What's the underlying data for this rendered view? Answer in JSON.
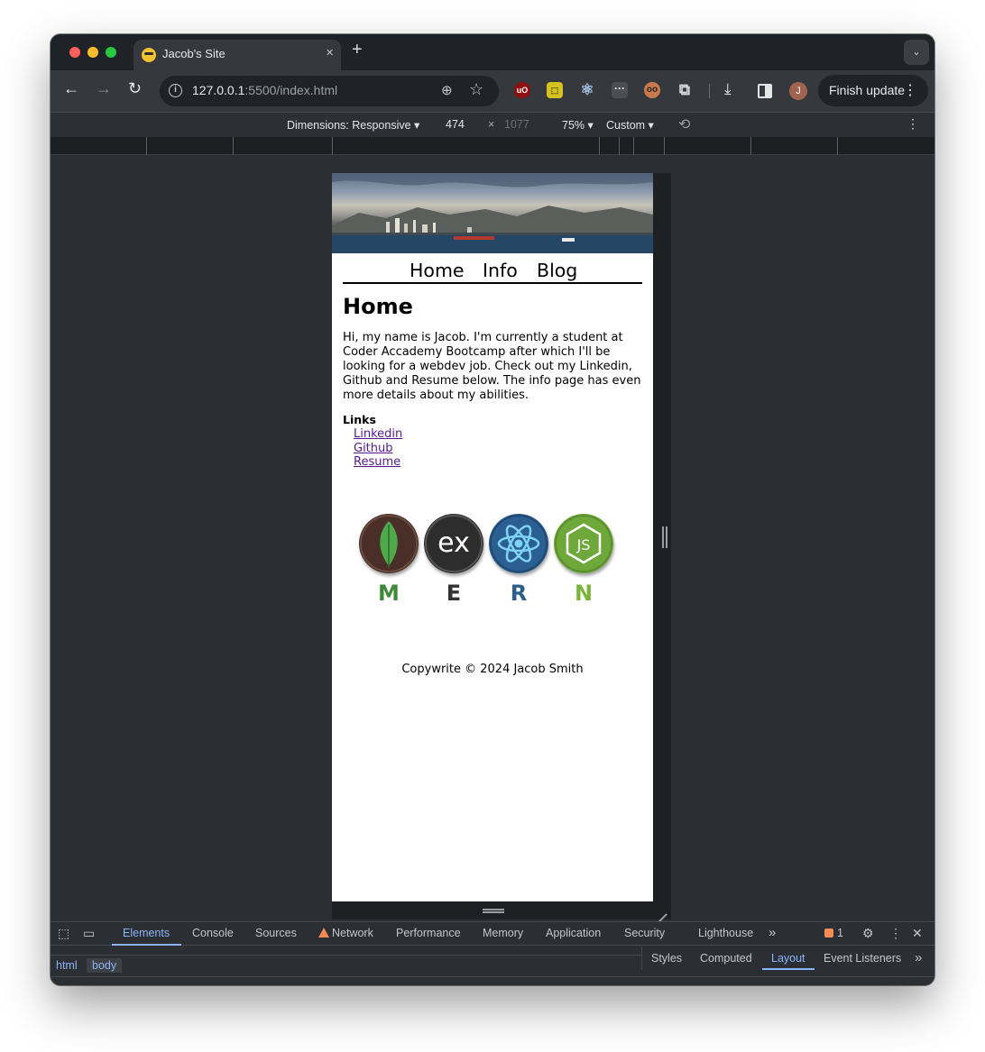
{
  "browser": {
    "tab": {
      "title": "Jacob's Site",
      "close_glyph": "×"
    },
    "new_tab_glyph": "+",
    "tab_search_glyph": "⌄",
    "url_host": "127.0.0.1",
    "url_path": ":5500/index.html",
    "info_glyph": "i",
    "profile_initial": "J",
    "finish_update_label": "Finish update",
    "colors": {
      "tab_bg": "#35393e",
      "window_bg": "#1f2327",
      "accent_blue": "#8ab4f8",
      "warning_orange": "#f28b54"
    }
  },
  "device_toolbar": {
    "dimensions_label": "Dimensions: Responsive ▾",
    "width": "474",
    "times_glyph": "×",
    "height": "1077",
    "zoom": "75% ▾",
    "throttle": "Custom ▾"
  },
  "site": {
    "nav": [
      "Home",
      "Info",
      "Blog"
    ],
    "heading": "Home",
    "intro": "Hi, my name is Jacob. I'm currently a student at Coder Accademy Bootcamp after which I'll be looking for a webdev job. Check out my Linkedin, Github and Resume below. The info page has even more details about my abilities.",
    "links_title": "Links",
    "links": [
      "Linkedin",
      "Github",
      "Resume"
    ],
    "mern": [
      {
        "letter": "M",
        "icon": "mongodb-leaf-icon",
        "color": "#3f8a3a",
        "bg": "#4a2f28"
      },
      {
        "letter": "E",
        "icon": "express-icon",
        "color": "#333333",
        "bg": "#2d2d2d",
        "glyph": "ex"
      },
      {
        "letter": "R",
        "icon": "react-atom-icon",
        "color": "#2d5f8c",
        "bg": "#2b5e91"
      },
      {
        "letter": "N",
        "icon": "nodejs-icon",
        "color": "#79b53a",
        "bg": "#6ea83a",
        "glyph": "JS"
      }
    ],
    "footer": "Copywrite © 2024 Jacob Smith"
  },
  "devtools": {
    "tabs": [
      "Elements",
      "Console",
      "Sources",
      "Network",
      "Performance",
      "Memory",
      "Application",
      "Security",
      "Lighthouse"
    ],
    "active_tab": "Elements",
    "more_tabs_glyph": "»",
    "issues_count": "1",
    "breadcrumbs": [
      "html",
      "body"
    ],
    "side_tabs": [
      "Styles",
      "Computed",
      "Layout",
      "Event Listeners"
    ],
    "active_side_tab": "Layout"
  }
}
